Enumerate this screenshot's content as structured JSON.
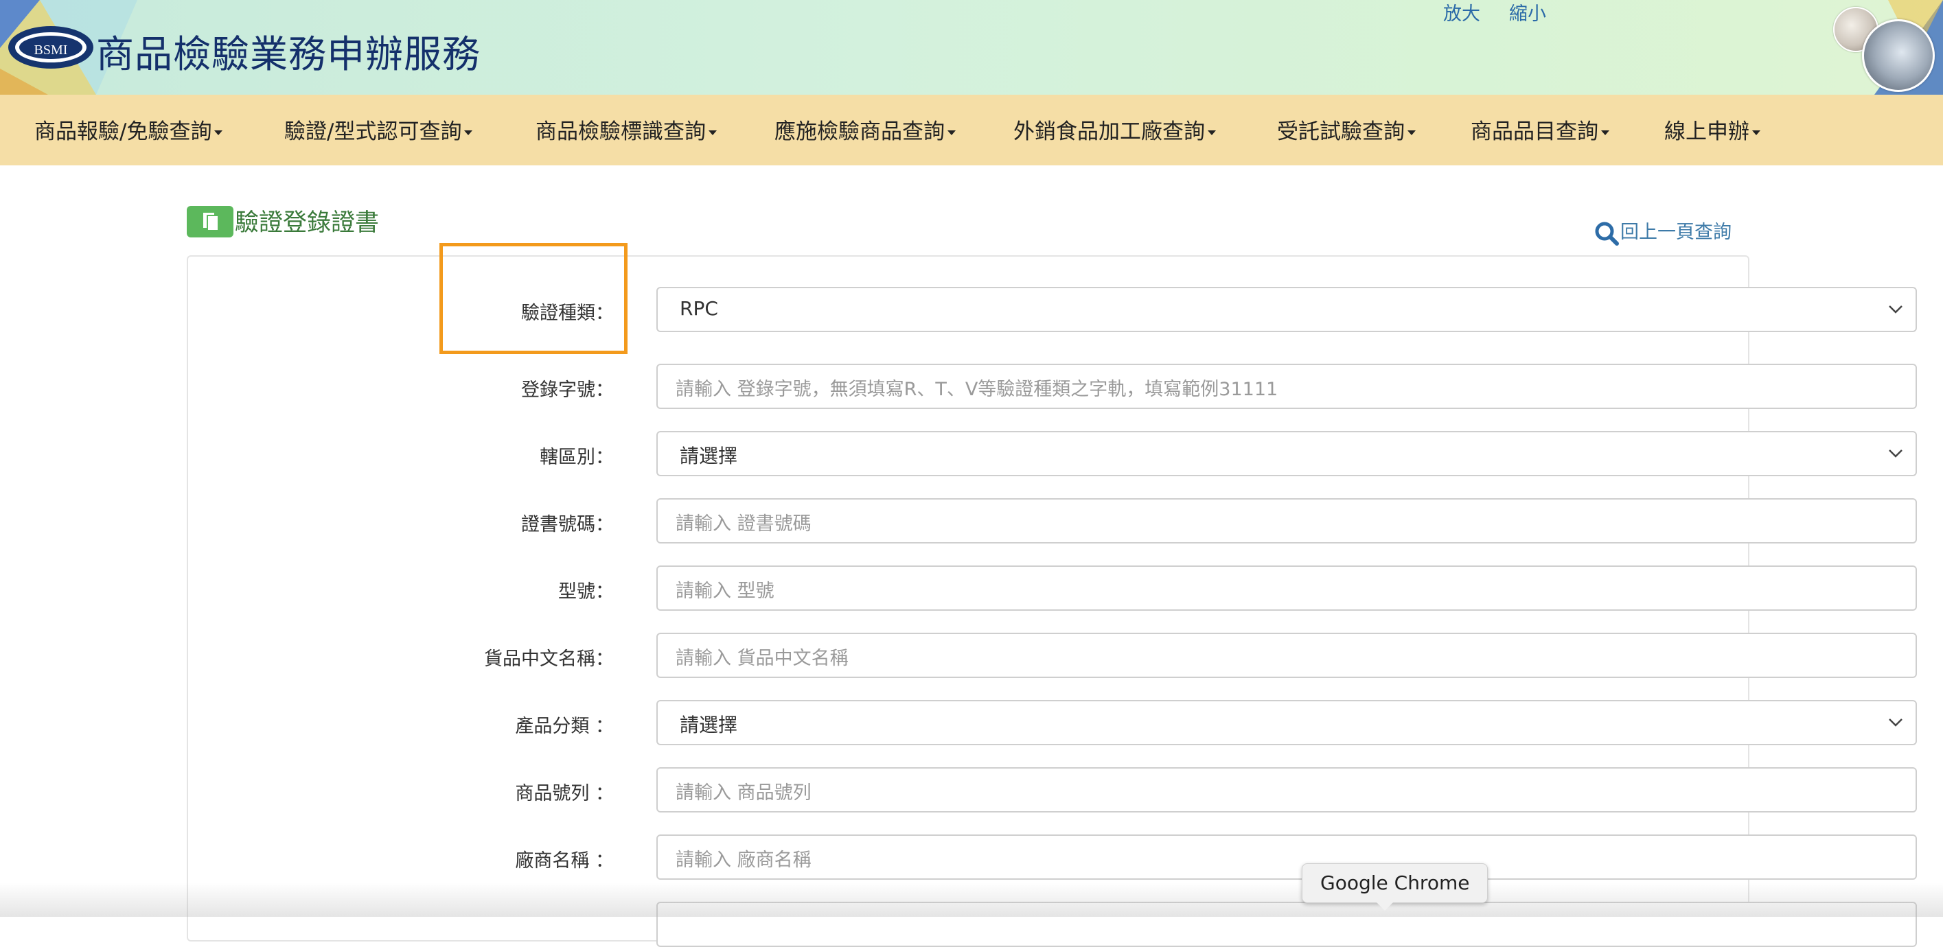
{
  "header": {
    "logo_text": "BSMI",
    "site_title": "商品檢驗業務申辦服務",
    "zoom_in": "放大",
    "zoom_out": "縮小"
  },
  "nav": {
    "items": [
      {
        "label": "商品報驗/免驗查詢"
      },
      {
        "label": "驗證/型式認可查詢"
      },
      {
        "label": "商品檢驗標識查詢"
      },
      {
        "label": "應施檢驗商品查詢"
      },
      {
        "label": "外銷食品加工廠查詢"
      },
      {
        "label": "受託試驗查詢"
      },
      {
        "label": "商品品目查詢"
      },
      {
        "label": "線上申辦"
      }
    ]
  },
  "page": {
    "title": "驗證登錄證書",
    "back_link": "回上一頁查詢"
  },
  "form": {
    "fields": [
      {
        "label": "驗證種類：",
        "type": "select",
        "value": "RPC"
      },
      {
        "label": "登錄字號：",
        "type": "input",
        "placeholder": "請輸入 登錄字號，無須填寫R、T、V等驗證種類之字軌，填寫範例31111"
      },
      {
        "label": "轄區別：",
        "type": "select",
        "value": "請選擇"
      },
      {
        "label": "證書號碼：",
        "type": "input",
        "placeholder": "請輸入 證書號碼"
      },
      {
        "label": "型號：",
        "type": "input",
        "placeholder": "請輸入 型號"
      },
      {
        "label": "貨品中文名稱：",
        "type": "input",
        "placeholder": "請輸入 貨品中文名稱"
      },
      {
        "label": "產品分類 ：",
        "type": "select",
        "value": "請選擇"
      },
      {
        "label": "商品號列 ：",
        "type": "input",
        "placeholder": "請輸入 商品號列"
      },
      {
        "label": "廠商名稱 ：",
        "type": "input",
        "placeholder": "請輸入 廠商名稱"
      }
    ]
  },
  "tooltip": {
    "text": "Google Chrome"
  },
  "colors": {
    "header_bg": "#d3f1dd",
    "nav_bg": "#f5dea6",
    "title_green": "#3a7a3a",
    "highlight_orange": "#f39a1c",
    "link_blue": "#3d7aa8"
  }
}
